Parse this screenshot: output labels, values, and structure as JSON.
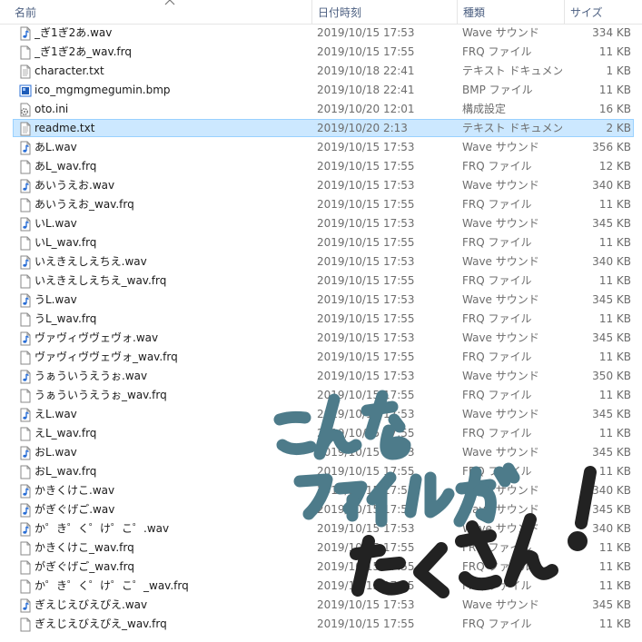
{
  "header": {
    "name": "名前",
    "date": "日付時刻",
    "type": "種類",
    "size": "サイズ"
  },
  "files": [
    {
      "name": "_ぎ1ぎ2あ.wav",
      "date": "2019/10/15 17:53",
      "type": "Wave サウンド",
      "size": "334 KB",
      "icon": "wave-file-icon"
    },
    {
      "name": "_ぎ1ぎ2あ_wav.frq",
      "date": "2019/10/15 17:55",
      "type": "FRQ ファイル",
      "size": "11 KB",
      "icon": "document-icon"
    },
    {
      "name": "character.txt",
      "date": "2019/10/18 22:41",
      "type": "テキスト ドキュメント",
      "size": "1 KB",
      "icon": "text-file-icon"
    },
    {
      "name": "ico_mgmgmegumin.bmp",
      "date": "2019/10/18 22:41",
      "type": "BMP ファイル",
      "size": "11 KB",
      "icon": "image-file-icon"
    },
    {
      "name": "oto.ini",
      "date": "2019/10/20 12:01",
      "type": "構成設定",
      "size": "16 KB",
      "icon": "settings-file-icon"
    },
    {
      "name": "readme.txt",
      "date": "2019/10/20 2:13",
      "type": "テキスト ドキュメント",
      "size": "2 KB",
      "icon": "text-file-icon",
      "selected": true
    },
    {
      "name": "あL.wav",
      "date": "2019/10/15 17:53",
      "type": "Wave サウンド",
      "size": "356 KB",
      "icon": "wave-file-icon"
    },
    {
      "name": "あL_wav.frq",
      "date": "2019/10/15 17:55",
      "type": "FRQ ファイル",
      "size": "12 KB",
      "icon": "document-icon"
    },
    {
      "name": "あいうえお.wav",
      "date": "2019/10/15 17:53",
      "type": "Wave サウンド",
      "size": "340 KB",
      "icon": "wave-file-icon"
    },
    {
      "name": "あいうえお_wav.frq",
      "date": "2019/10/15 17:55",
      "type": "FRQ ファイル",
      "size": "11 KB",
      "icon": "document-icon"
    },
    {
      "name": "いL.wav",
      "date": "2019/10/15 17:53",
      "type": "Wave サウンド",
      "size": "345 KB",
      "icon": "wave-file-icon"
    },
    {
      "name": "いL_wav.frq",
      "date": "2019/10/15 17:55",
      "type": "FRQ ファイル",
      "size": "11 KB",
      "icon": "document-icon"
    },
    {
      "name": "いえきえしえちえ.wav",
      "date": "2019/10/15 17:53",
      "type": "Wave サウンド",
      "size": "340 KB",
      "icon": "wave-file-icon"
    },
    {
      "name": "いえきえしえちえ_wav.frq",
      "date": "2019/10/15 17:55",
      "type": "FRQ ファイル",
      "size": "11 KB",
      "icon": "document-icon"
    },
    {
      "name": "うL.wav",
      "date": "2019/10/15 17:53",
      "type": "Wave サウンド",
      "size": "345 KB",
      "icon": "wave-file-icon"
    },
    {
      "name": "うL_wav.frq",
      "date": "2019/10/15 17:55",
      "type": "FRQ ファイル",
      "size": "11 KB",
      "icon": "document-icon"
    },
    {
      "name": "ヴァヴィヴヴェヴォ.wav",
      "date": "2019/10/15 17:53",
      "type": "Wave サウンド",
      "size": "345 KB",
      "icon": "wave-file-icon"
    },
    {
      "name": "ヴァヴィヴヴェヴォ_wav.frq",
      "date": "2019/10/15 17:55",
      "type": "FRQ ファイル",
      "size": "11 KB",
      "icon": "document-icon"
    },
    {
      "name": "うぁういうえうぉ.wav",
      "date": "2019/10/15 17:53",
      "type": "Wave サウンド",
      "size": "350 KB",
      "icon": "wave-file-icon"
    },
    {
      "name": "うぁういうえうぉ_wav.frq",
      "date": "2019/10/15 17:55",
      "type": "FRQ ファイル",
      "size": "11 KB",
      "icon": "document-icon"
    },
    {
      "name": "えL.wav",
      "date": "2019/10/15 17:53",
      "type": "Wave サウンド",
      "size": "345 KB",
      "icon": "wave-file-icon"
    },
    {
      "name": "えL_wav.frq",
      "date": "2019/10/15 17:55",
      "type": "FRQ ファイル",
      "size": "11 KB",
      "icon": "document-icon"
    },
    {
      "name": "おL.wav",
      "date": "2019/10/15 17:53",
      "type": "Wave サウンド",
      "size": "345 KB",
      "icon": "wave-file-icon"
    },
    {
      "name": "おL_wav.frq",
      "date": "2019/10/15 17:55",
      "type": "FRQ ファイル",
      "size": "11 KB",
      "icon": "document-icon"
    },
    {
      "name": "かきくけこ.wav",
      "date": "2019/10/15 17:53",
      "type": "Wave サウンド",
      "size": "340 KB",
      "icon": "wave-file-icon"
    },
    {
      "name": "がぎぐげご.wav",
      "date": "2019/10/15 17:53",
      "type": "Wave サウンド",
      "size": "345 KB",
      "icon": "wave-file-icon"
    },
    {
      "name": "か゜き゜く゜け゜こ゜.wav",
      "date": "2019/10/15 17:53",
      "type": "Wave サウンド",
      "size": "340 KB",
      "icon": "wave-file-icon"
    },
    {
      "name": "かきくけこ_wav.frq",
      "date": "2019/10/15 17:55",
      "type": "FRQ ファイル",
      "size": "11 KB",
      "icon": "document-icon"
    },
    {
      "name": "がぎぐげご_wav.frq",
      "date": "2019/10/15 17:55",
      "type": "FRQ ファイル",
      "size": "11 KB",
      "icon": "document-icon"
    },
    {
      "name": "か゜き゜く゜け゜こ゜_wav.frq",
      "date": "2019/10/15 17:55",
      "type": "FRQ ファイル",
      "size": "11 KB",
      "icon": "document-icon"
    },
    {
      "name": "ぎえじえびえぴえ.wav",
      "date": "2019/10/15 17:53",
      "type": "Wave サウンド",
      "size": "345 KB",
      "icon": "wave-file-icon"
    },
    {
      "name": "ぎえじえびえぴえ_wav.frq",
      "date": "2019/10/15 17:55",
      "type": "FRQ ファイル",
      "size": "11 KB",
      "icon": "document-icon"
    }
  ],
  "overlay": {
    "lines": [
      "こんな",
      "ファイルが",
      "たくさん！"
    ],
    "color": "#4d7b8a",
    "ink": "#222222"
  }
}
